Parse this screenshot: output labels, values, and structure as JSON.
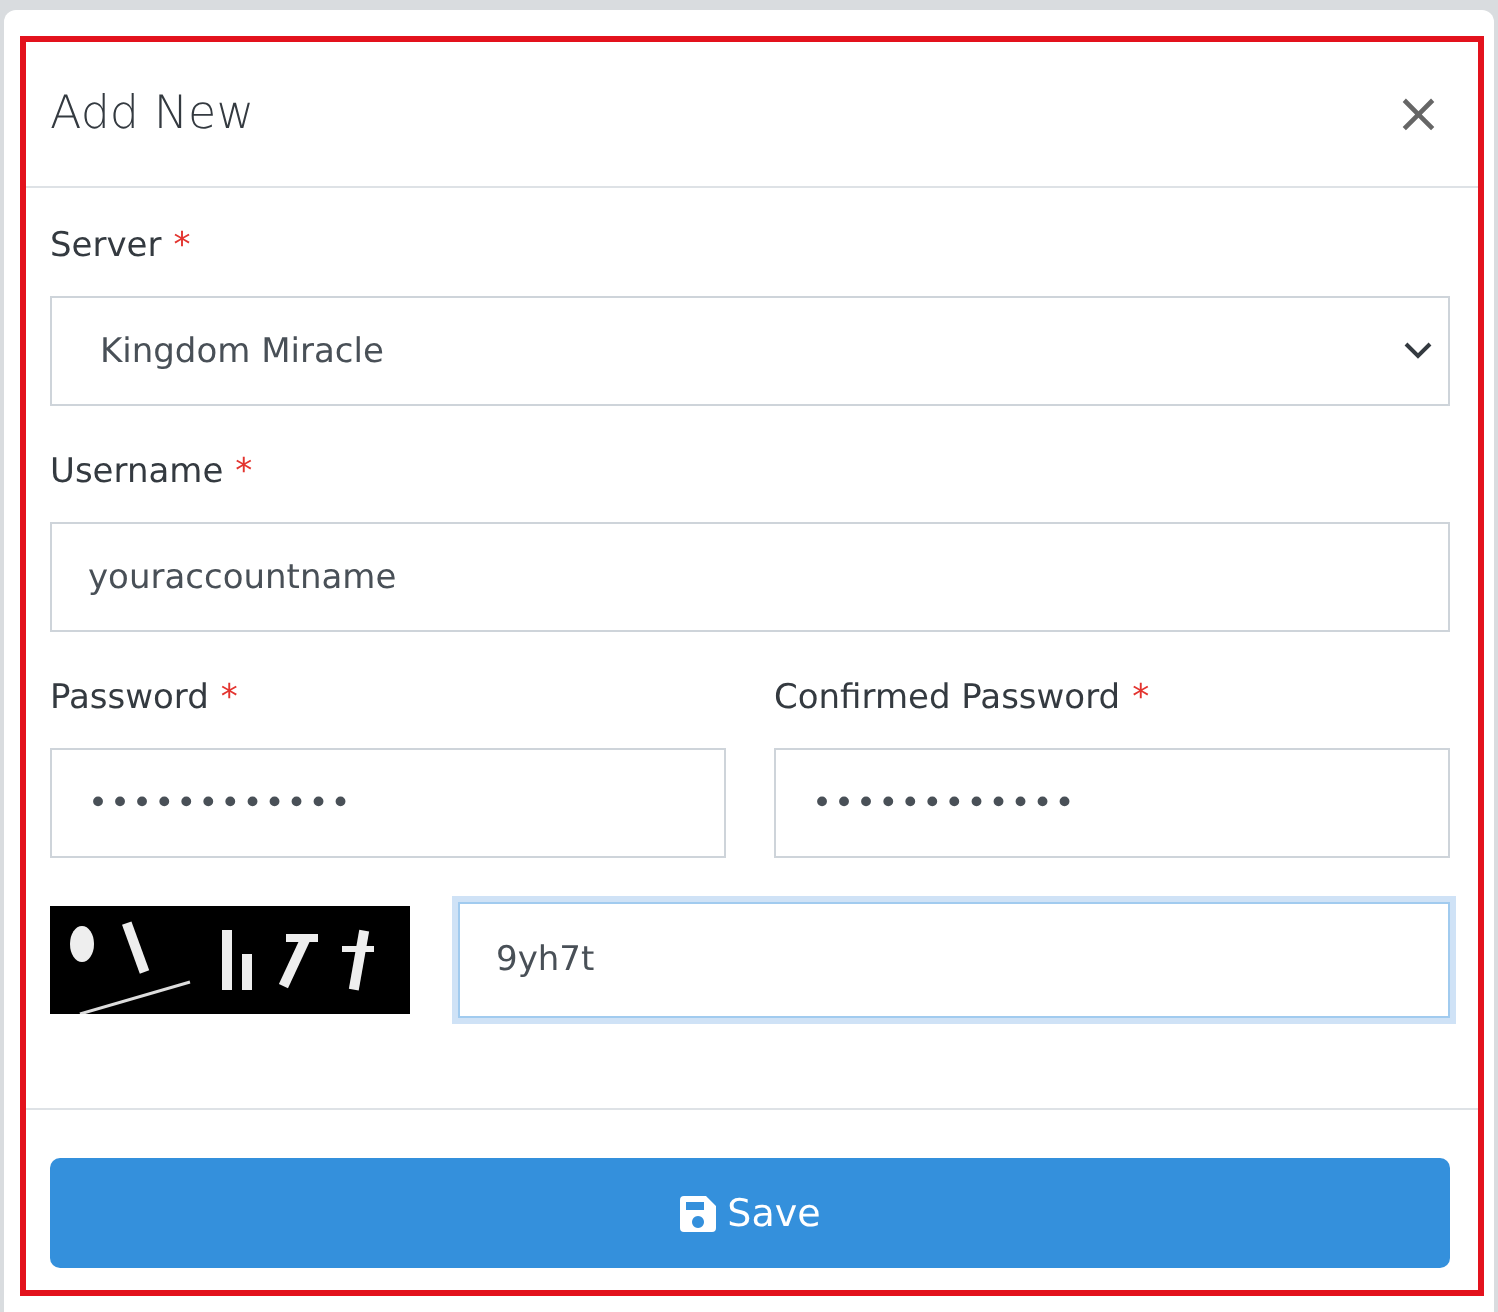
{
  "dialog": {
    "title": "Add New",
    "close": "×"
  },
  "fields": [
    {
      "kind": "select",
      "label": "Server",
      "required": true,
      "value": "Kingdom Miracle"
    },
    {
      "kind": "text",
      "label": "Username",
      "required": true,
      "value": "youraccountname"
    },
    {
      "kind": "pair",
      "items": [
        {
          "label": "Password",
          "required": true,
          "value": "••••••••••••"
        },
        {
          "label": "Confirmed Password",
          "required": true,
          "value": "••••••••••••"
        }
      ]
    },
    {
      "kind": "captcha",
      "value": "9yh7t",
      "focused": true
    }
  ],
  "required_mark": "*",
  "save_button": {
    "label": "Save"
  }
}
